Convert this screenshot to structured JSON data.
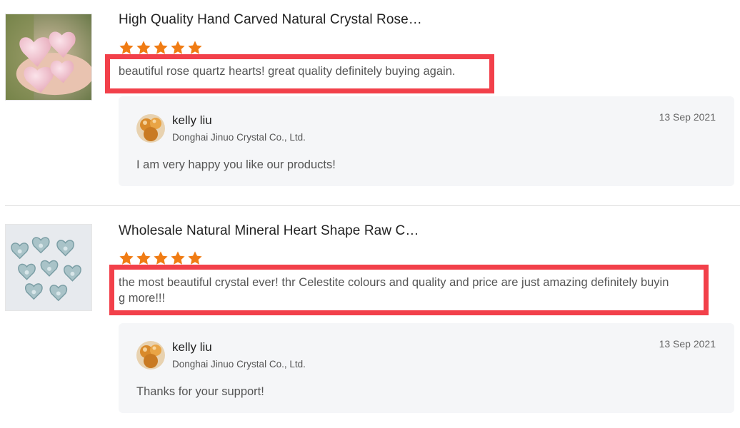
{
  "reviews": [
    {
      "product_title": "High Quality Hand Carved Natural Crystal Rose…",
      "rating": 5,
      "review_text": "beautiful rose quartz hearts! great quality definitely buying again.",
      "reply": {
        "name": "kelly liu",
        "company": "Donghai Jinuo Crystal Co., Ltd.",
        "date": "13 Sep 2021",
        "text": "I am very happy you like our products!"
      }
    },
    {
      "product_title": "Wholesale Natural Mineral Heart Shape Raw C…",
      "rating": 5,
      "review_text_line1": "the most beautiful crystal ever! thr Celestite  colours and quality and price are just amazing definitely buyin",
      "review_text_line2": "g more!!!",
      "reply": {
        "name": "kelly liu",
        "company": "Donghai Jinuo Crystal Co., Ltd.",
        "date": "13 Sep 2021",
        "text": "Thanks for your support!"
      }
    }
  ],
  "colors": {
    "star": "#f07c14",
    "highlight": "#f2404a",
    "reply_bg": "#f5f6f8"
  },
  "icons": [
    "star-icon",
    "avatar-image",
    "product-thumbnail"
  ]
}
